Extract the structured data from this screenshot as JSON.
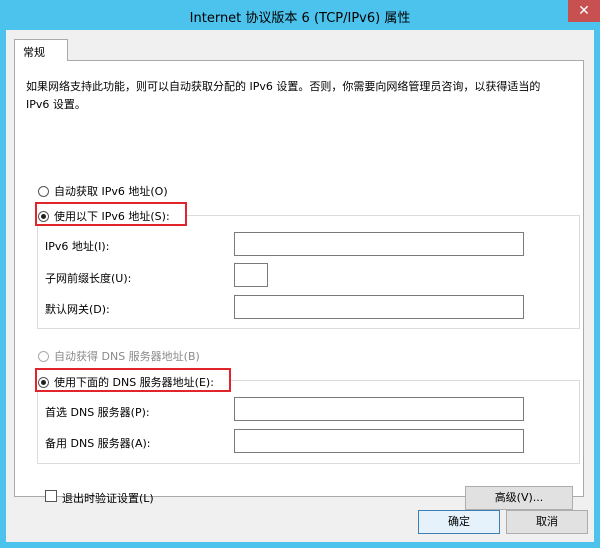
{
  "window": {
    "title": "Internet 协议版本 6 (TCP/IPv6) 属性",
    "close_glyph": "✕"
  },
  "tabs": [
    {
      "label": "常规"
    }
  ],
  "description": "如果网络支持此功能，则可以自动获取分配的 IPv6 设置。否则，你需要向网络管理员咨询，以获得适当的 IPv6 设置。",
  "ip_section": {
    "auto_option": "自动获取 IPv6 地址(O)",
    "manual_option": "使用以下 IPv6 地址(S):",
    "ipv6_address_label": "IPv6 地址(I):",
    "ipv6_address_value": "",
    "prefix_length_label": "子网前缀长度(U):",
    "prefix_length_value": "",
    "gateway_label": "默认网关(D):",
    "gateway_value": ""
  },
  "dns_section": {
    "auto_option": "自动获得 DNS 服务器地址(B)",
    "manual_option": "使用下面的 DNS 服务器地址(E):",
    "preferred_label": "首选 DNS 服务器(P):",
    "preferred_value": "",
    "alternate_label": "备用 DNS 服务器(A):",
    "alternate_value": ""
  },
  "validate_on_exit_label": "退出时验证设置(L)",
  "advanced_button": "高级(V)...",
  "ok_button": "确定",
  "cancel_button": "取消",
  "colors": {
    "titlebar": "#4cc3ed",
    "close_button": "#c75050",
    "highlight_box": "#e0262a"
  }
}
